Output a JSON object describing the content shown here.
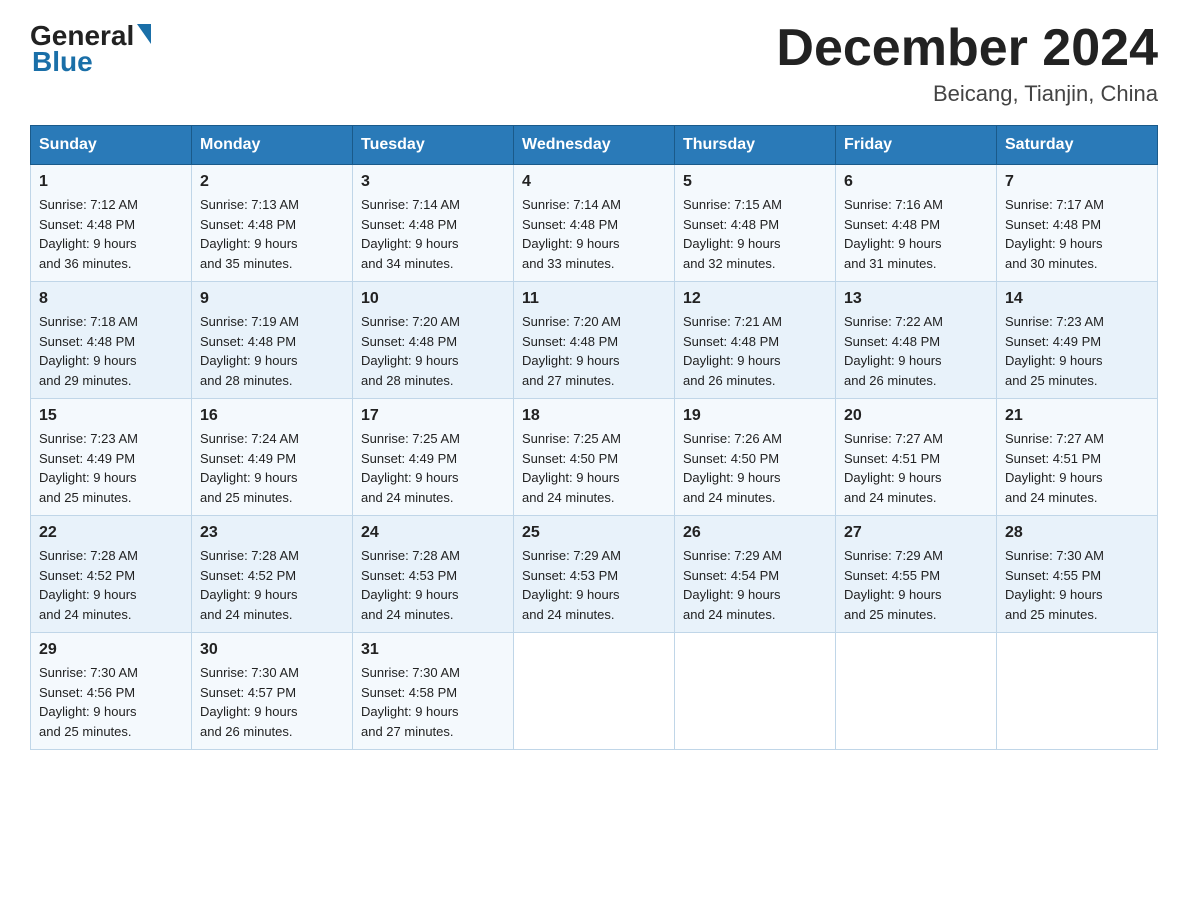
{
  "logo": {
    "general": "General",
    "blue": "Blue"
  },
  "header": {
    "month": "December 2024",
    "location": "Beicang, Tianjin, China"
  },
  "days_of_week": [
    "Sunday",
    "Monday",
    "Tuesday",
    "Wednesday",
    "Thursday",
    "Friday",
    "Saturday"
  ],
  "weeks": [
    [
      {
        "day": "1",
        "sunrise": "7:12 AM",
        "sunset": "4:48 PM",
        "daylight": "9 hours and 36 minutes."
      },
      {
        "day": "2",
        "sunrise": "7:13 AM",
        "sunset": "4:48 PM",
        "daylight": "9 hours and 35 minutes."
      },
      {
        "day": "3",
        "sunrise": "7:14 AM",
        "sunset": "4:48 PM",
        "daylight": "9 hours and 34 minutes."
      },
      {
        "day": "4",
        "sunrise": "7:14 AM",
        "sunset": "4:48 PM",
        "daylight": "9 hours and 33 minutes."
      },
      {
        "day": "5",
        "sunrise": "7:15 AM",
        "sunset": "4:48 PM",
        "daylight": "9 hours and 32 minutes."
      },
      {
        "day": "6",
        "sunrise": "7:16 AM",
        "sunset": "4:48 PM",
        "daylight": "9 hours and 31 minutes."
      },
      {
        "day": "7",
        "sunrise": "7:17 AM",
        "sunset": "4:48 PM",
        "daylight": "9 hours and 30 minutes."
      }
    ],
    [
      {
        "day": "8",
        "sunrise": "7:18 AM",
        "sunset": "4:48 PM",
        "daylight": "9 hours and 29 minutes."
      },
      {
        "day": "9",
        "sunrise": "7:19 AM",
        "sunset": "4:48 PM",
        "daylight": "9 hours and 28 minutes."
      },
      {
        "day": "10",
        "sunrise": "7:20 AM",
        "sunset": "4:48 PM",
        "daylight": "9 hours and 28 minutes."
      },
      {
        "day": "11",
        "sunrise": "7:20 AM",
        "sunset": "4:48 PM",
        "daylight": "9 hours and 27 minutes."
      },
      {
        "day": "12",
        "sunrise": "7:21 AM",
        "sunset": "4:48 PM",
        "daylight": "9 hours and 26 minutes."
      },
      {
        "day": "13",
        "sunrise": "7:22 AM",
        "sunset": "4:48 PM",
        "daylight": "9 hours and 26 minutes."
      },
      {
        "day": "14",
        "sunrise": "7:23 AM",
        "sunset": "4:49 PM",
        "daylight": "9 hours and 25 minutes."
      }
    ],
    [
      {
        "day": "15",
        "sunrise": "7:23 AM",
        "sunset": "4:49 PM",
        "daylight": "9 hours and 25 minutes."
      },
      {
        "day": "16",
        "sunrise": "7:24 AM",
        "sunset": "4:49 PM",
        "daylight": "9 hours and 25 minutes."
      },
      {
        "day": "17",
        "sunrise": "7:25 AM",
        "sunset": "4:49 PM",
        "daylight": "9 hours and 24 minutes."
      },
      {
        "day": "18",
        "sunrise": "7:25 AM",
        "sunset": "4:50 PM",
        "daylight": "9 hours and 24 minutes."
      },
      {
        "day": "19",
        "sunrise": "7:26 AM",
        "sunset": "4:50 PM",
        "daylight": "9 hours and 24 minutes."
      },
      {
        "day": "20",
        "sunrise": "7:27 AM",
        "sunset": "4:51 PM",
        "daylight": "9 hours and 24 minutes."
      },
      {
        "day": "21",
        "sunrise": "7:27 AM",
        "sunset": "4:51 PM",
        "daylight": "9 hours and 24 minutes."
      }
    ],
    [
      {
        "day": "22",
        "sunrise": "7:28 AM",
        "sunset": "4:52 PM",
        "daylight": "9 hours and 24 minutes."
      },
      {
        "day": "23",
        "sunrise": "7:28 AM",
        "sunset": "4:52 PM",
        "daylight": "9 hours and 24 minutes."
      },
      {
        "day": "24",
        "sunrise": "7:28 AM",
        "sunset": "4:53 PM",
        "daylight": "9 hours and 24 minutes."
      },
      {
        "day": "25",
        "sunrise": "7:29 AM",
        "sunset": "4:53 PM",
        "daylight": "9 hours and 24 minutes."
      },
      {
        "day": "26",
        "sunrise": "7:29 AM",
        "sunset": "4:54 PM",
        "daylight": "9 hours and 24 minutes."
      },
      {
        "day": "27",
        "sunrise": "7:29 AM",
        "sunset": "4:55 PM",
        "daylight": "9 hours and 25 minutes."
      },
      {
        "day": "28",
        "sunrise": "7:30 AM",
        "sunset": "4:55 PM",
        "daylight": "9 hours and 25 minutes."
      }
    ],
    [
      {
        "day": "29",
        "sunrise": "7:30 AM",
        "sunset": "4:56 PM",
        "daylight": "9 hours and 25 minutes."
      },
      {
        "day": "30",
        "sunrise": "7:30 AM",
        "sunset": "4:57 PM",
        "daylight": "9 hours and 26 minutes."
      },
      {
        "day": "31",
        "sunrise": "7:30 AM",
        "sunset": "4:58 PM",
        "daylight": "9 hours and 27 minutes."
      },
      null,
      null,
      null,
      null
    ]
  ],
  "labels": {
    "sunrise": "Sunrise:",
    "sunset": "Sunset:",
    "daylight": "Daylight:"
  }
}
